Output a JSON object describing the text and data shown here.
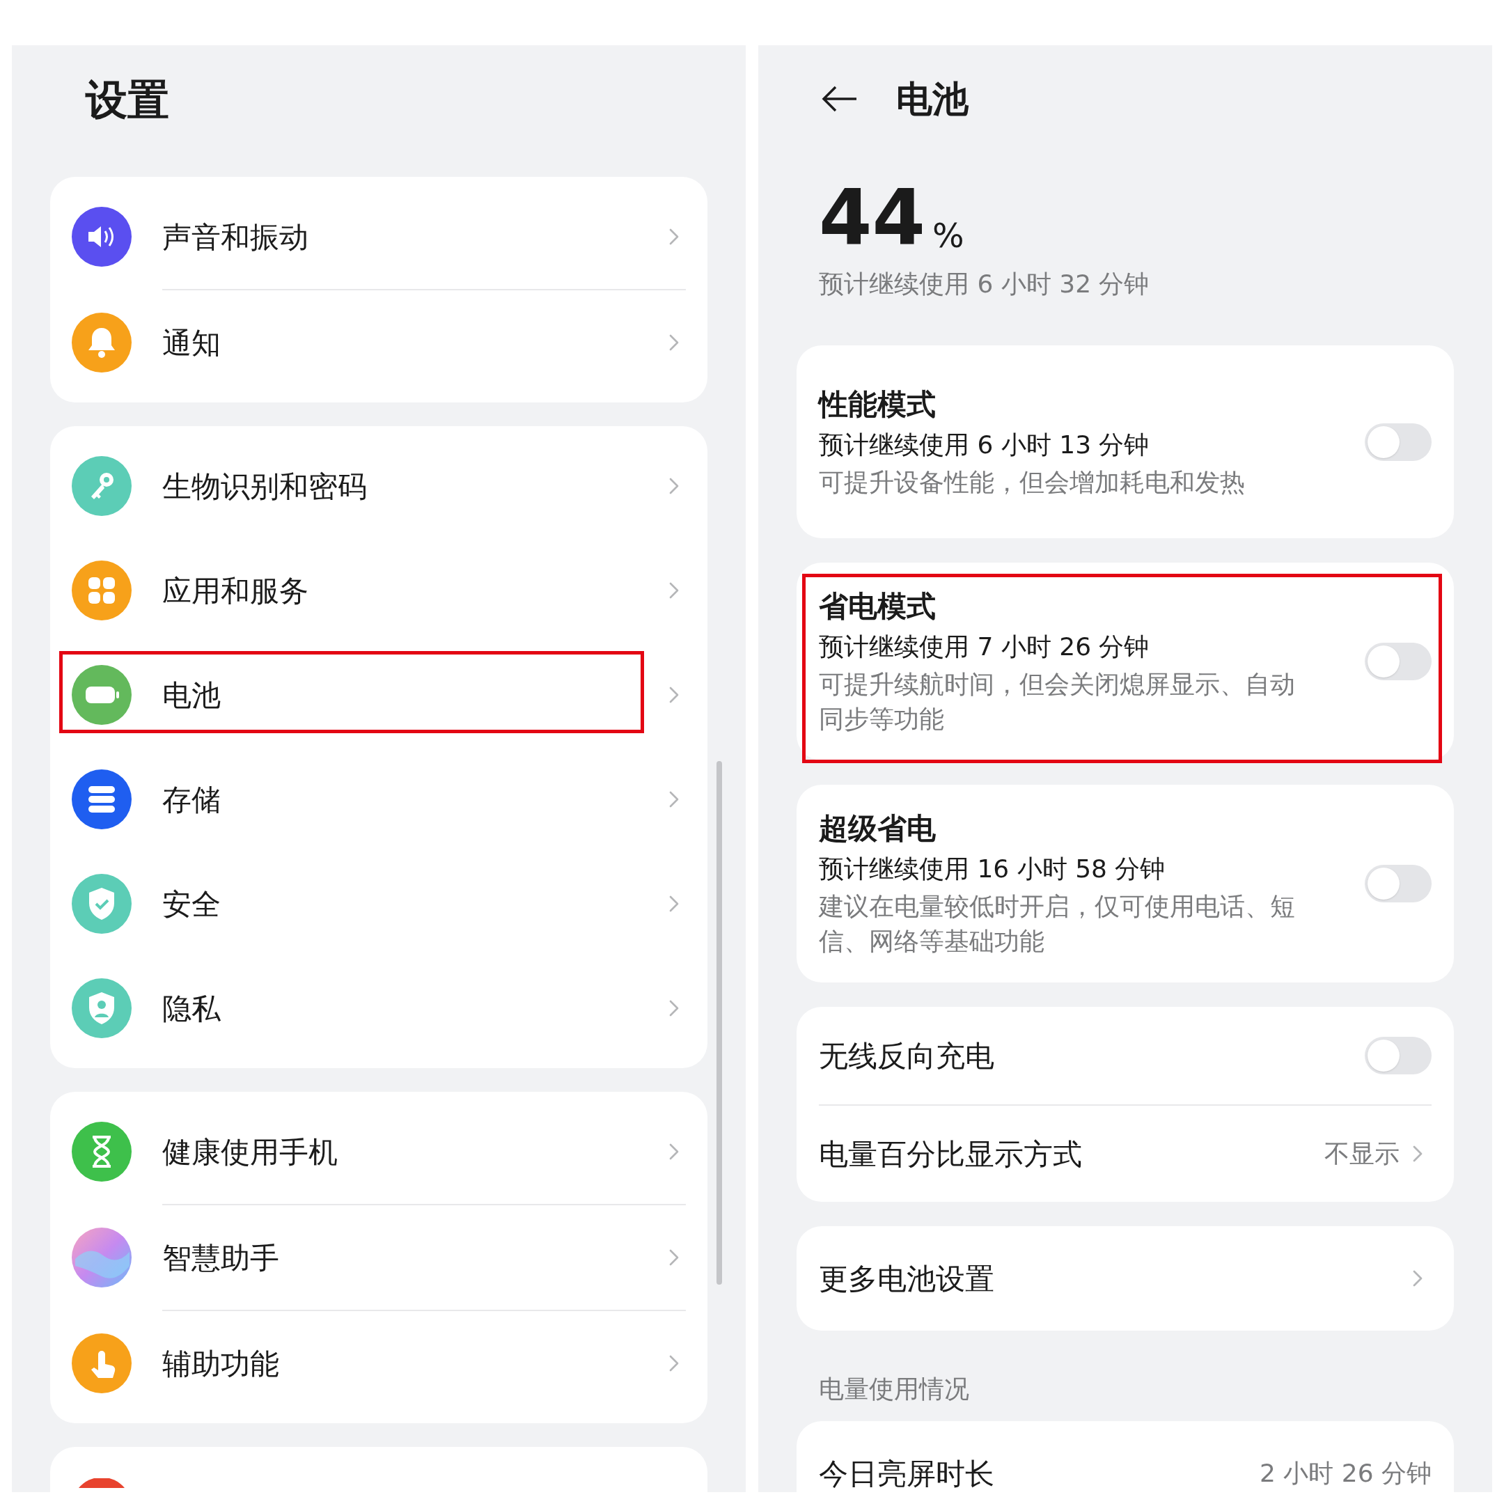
{
  "settings": {
    "title": "设置",
    "sections": [
      {
        "items": [
          {
            "label": "声音和振动",
            "highlighted": false
          },
          {
            "label": "通知",
            "highlighted": false
          }
        ]
      },
      {
        "items": [
          {
            "label": "生物识别和密码",
            "highlighted": false
          },
          {
            "label": "应用和服务",
            "highlighted": false
          },
          {
            "label": "电池",
            "highlighted": true
          },
          {
            "label": "存储",
            "highlighted": false
          },
          {
            "label": "安全",
            "highlighted": false
          },
          {
            "label": "隐私",
            "highlighted": false
          }
        ]
      },
      {
        "items": [
          {
            "label": "健康使用手机",
            "highlighted": false
          },
          {
            "label": "智慧助手",
            "highlighted": false
          },
          {
            "label": "辅助功能",
            "highlighted": false
          }
        ]
      }
    ]
  },
  "battery": {
    "title": "电池",
    "percent": "44",
    "percent_unit": "%",
    "estimate": "预计继续使用 6 小时 32 分钟",
    "modes": [
      {
        "title": "性能模式",
        "estimate": "预计继续使用 6 小时 13 分钟",
        "description": "可提升设备性能，但会增加耗电和发热",
        "on": false,
        "highlighted": false
      },
      {
        "title": "省电模式",
        "estimate": "预计继续使用 7 小时 26 分钟",
        "description": "可提升续航时间，但会关闭熄屏显示、自动同步等功能",
        "on": false,
        "highlighted": true
      },
      {
        "title": "超级省电",
        "estimate": "预计继续使用 16 小时 58 分钟",
        "description": "建议在电量较低时开启，仅可使用电话、短信、网络等基础功能",
        "on": false,
        "highlighted": false
      }
    ],
    "options": [
      {
        "kind": "toggle",
        "label": "无线反向充电",
        "on": false
      },
      {
        "kind": "link",
        "label": "电量百分比显示方式",
        "value": "不显示"
      }
    ],
    "more": {
      "label": "更多电池设置"
    },
    "usage_section": "电量使用情况",
    "usage_rows": [
      {
        "label": "今日亮屏时长",
        "value": "2 小时 26 分钟"
      }
    ]
  }
}
